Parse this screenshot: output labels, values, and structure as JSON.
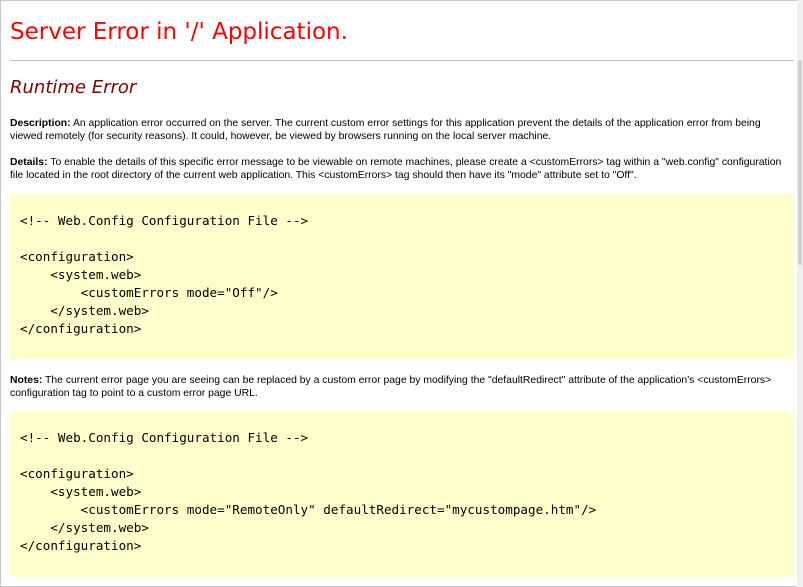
{
  "page": {
    "title": "Server Error in '/' Application.",
    "subtitle": "Runtime Error"
  },
  "description": {
    "label": "Description:",
    "text": " An application error occurred on the server. The current custom error settings for this application prevent the details of the application error from being viewed remotely (for security reasons). It could, however, be viewed by browsers running on the local server machine."
  },
  "details": {
    "label": "Details:",
    "text": " To enable the details of this specific error message to be viewable on remote machines, please create a <customErrors> tag within a \"web.config\" configuration file located in the root directory of the current web application. This <customErrors> tag should then have its \"mode\" attribute set to \"Off\"."
  },
  "code_block_1": {
    "text": "\n<!-- Web.Config Configuration File -->\n\n<configuration>\n    <system.web>\n        <customErrors mode=\"Off\"/>\n    </system.web>\n</configuration>"
  },
  "notes": {
    "label": "Notes:",
    "text": " The current error page you are seeing can be replaced by a custom error page by modifying the \"defaultRedirect\" attribute of the application's <customErrors> configuration tag to point to a custom error page URL."
  },
  "code_block_2": {
    "text": "\n<!-- Web.Config Configuration File -->\n\n<configuration>\n    <system.web>\n        <customErrors mode=\"RemoteOnly\" defaultRedirect=\"mycustompage.htm\"/>\n    </system.web>\n</configuration>"
  },
  "colors": {
    "title": "#ff0000",
    "subtitle": "#800000",
    "code_background": "#ffffcc"
  }
}
